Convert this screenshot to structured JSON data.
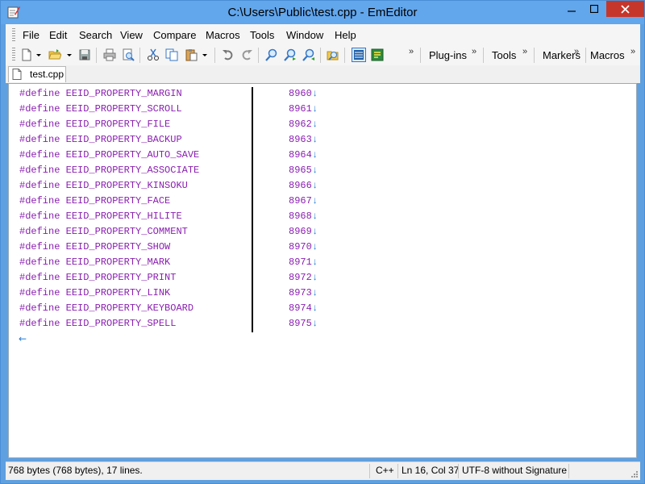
{
  "window": {
    "title": "C:\\Users\\Public\\test.cpp - EmEditor"
  },
  "menu": [
    "File",
    "Edit",
    "Search",
    "View",
    "Compare",
    "Macros",
    "Tools",
    "Window",
    "Help"
  ],
  "toolbar_groups": {
    "chevron": "»",
    "plugins": "Plug-ins",
    "tools": "Tools",
    "markers": "Markers",
    "macros": "Macros"
  },
  "toolbar_icons": [
    "new-file-icon",
    "open-folder-icon",
    "save-icon",
    "print-icon",
    "print-preview-icon",
    "cut-icon",
    "copy-icon",
    "paste-icon",
    "undo-icon",
    "redo-icon",
    "find-icon",
    "find-next-icon",
    "find-previous-icon",
    "find-in-files-icon",
    "toggle-view-icon",
    "markers-toggle-icon"
  ],
  "tab": {
    "label": "test.cpp"
  },
  "editor": {
    "keyword": "#define",
    "newline_mark": "↓",
    "eof_mark": "←",
    "lines": [
      {
        "name": "EEID_PROPERTY_MARGIN",
        "value": "8960"
      },
      {
        "name": "EEID_PROPERTY_SCROLL",
        "value": "8961"
      },
      {
        "name": "EEID_PROPERTY_FILE",
        "value": "8962"
      },
      {
        "name": "EEID_PROPERTY_BACKUP",
        "value": "8963"
      },
      {
        "name": "EEID_PROPERTY_AUTO_SAVE",
        "value": "8964"
      },
      {
        "name": "EEID_PROPERTY_ASSOCIATE",
        "value": "8965"
      },
      {
        "name": "EEID_PROPERTY_KINSOKU",
        "value": "8966"
      },
      {
        "name": "EEID_PROPERTY_FACE",
        "value": "8967"
      },
      {
        "name": "EEID_PROPERTY_HILITE",
        "value": "8968"
      },
      {
        "name": "EEID_PROPERTY_COMMENT",
        "value": "8969"
      },
      {
        "name": "EEID_PROPERTY_SHOW",
        "value": "8970"
      },
      {
        "name": "EEID_PROPERTY_MARK",
        "value": "8971"
      },
      {
        "name": "EEID_PROPERTY_PRINT",
        "value": "8972"
      },
      {
        "name": "EEID_PROPERTY_LINK",
        "value": "8973"
      },
      {
        "name": "EEID_PROPERTY_KEYBOARD",
        "value": "8974"
      },
      {
        "name": "EEID_PROPERTY_SPELL",
        "value": "8975"
      }
    ]
  },
  "status": {
    "info": "768 bytes (768 bytes), 17 lines.",
    "language": "C++",
    "position": "Ln 16, Col 37",
    "encoding": "UTF-8 without Signature"
  },
  "colors": {
    "accent": "#62a6ec",
    "code_text": "#8a1fb0",
    "marks": "#2a7fd6",
    "close_button": "#c7362b"
  }
}
